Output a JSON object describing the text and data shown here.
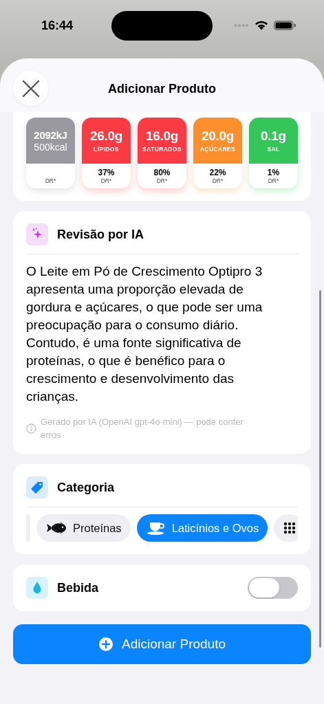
{
  "status_bar": {
    "time": "16:44"
  },
  "sheet": {
    "title": "Adicionar Produto"
  },
  "nutrition": [
    {
      "value": "2092kJ",
      "subvalue": "500kcal",
      "dr": "DR*",
      "color": "#9a999f"
    },
    {
      "value": "26.0g",
      "label": "LÍPIDOS",
      "percent": "37%",
      "dr": "DR*",
      "color": "#fb3b44"
    },
    {
      "value": "16.0g",
      "label": "SATURADOS",
      "percent": "80%",
      "dr": "DR*",
      "color": "#fb3b44"
    },
    {
      "value": "20.0g",
      "label": "AÇÚCARES",
      "percent": "22%",
      "dr": "DR*",
      "color": "#fd8f2c"
    },
    {
      "value": "0.1g",
      "label": "SAL",
      "percent": "1%",
      "dr": "DR*",
      "color": "#35c659"
    }
  ],
  "ai_review": {
    "title": "Revisão por IA",
    "text": "O Leite em Pó de Crescimento Optipro 3 apresenta uma proporção elevada de gordura e açúcares, o que pode ser uma preocupação para o consumo diário. Contudo, é uma fonte significativa de proteínas, o que é benéfico para o crescimento e desenvolvimento das crianças.",
    "note": "Gerado por IA (OpenAI gpt-4o-mini) — pode conter erros"
  },
  "category": {
    "title": "Categoria",
    "chips": [
      {
        "kind": "fish",
        "label": "Proteínas",
        "selected": false
      },
      {
        "kind": "cup",
        "label": "Laticínios e Ovos",
        "selected": true
      },
      {
        "kind": "grid",
        "selected": false
      }
    ]
  },
  "beverage": {
    "label": "Bebida",
    "on": false
  },
  "add_button": {
    "label": "Adicionar Produto"
  }
}
